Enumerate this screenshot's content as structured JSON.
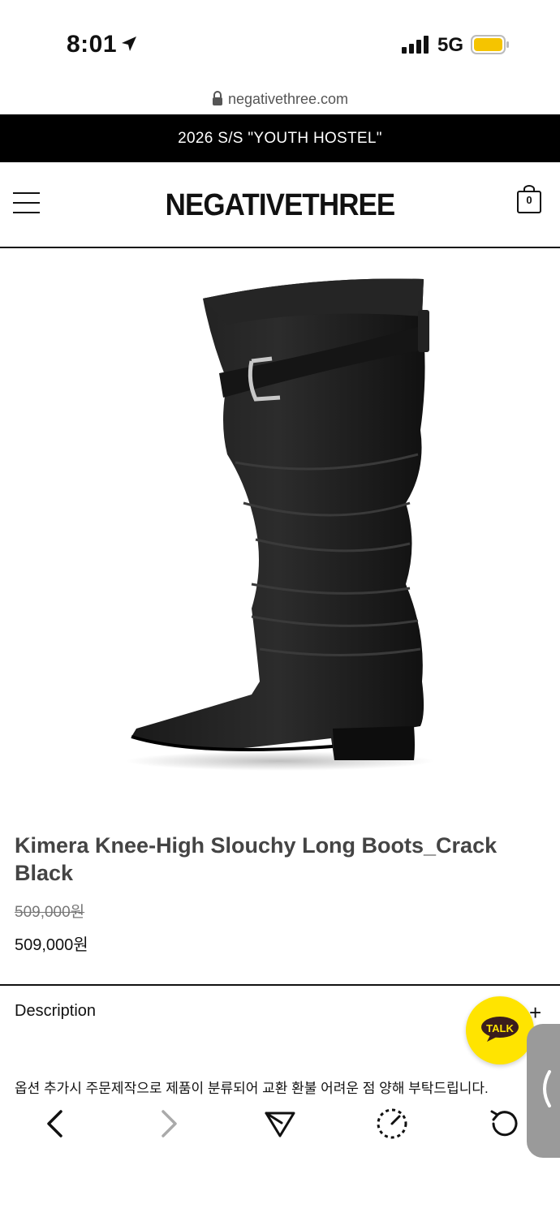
{
  "status": {
    "time": "8:01",
    "network": "5G",
    "battery_color": "#f5c400"
  },
  "browser": {
    "url": "negativethree.com"
  },
  "announcement": "2026 S/S \"YOUTH HOSTEL\"",
  "header": {
    "logo": "NEGATIVETHREE",
    "cart_count": "0",
    "menu_icon": "hamburger-icon",
    "cart_icon": "shopping-bag-icon"
  },
  "product": {
    "image": "black knee-high slouchy leather boot with buckle strap",
    "title": "Kimera Knee-High Slouchy Long Boots_Crack Black",
    "price_original": "509,000원",
    "price_current": "509,000원"
  },
  "description": {
    "label": "Description",
    "expand_icon": "+",
    "notice": "옵션 추가시 주문제작으로 제품이 분류되어 교환 환불 어려운 점 양해 부탁드립니다."
  },
  "chat": {
    "label": "TALK",
    "color": "#ffe400"
  },
  "toolbar": {
    "items": [
      "back-icon",
      "forward-icon",
      "share-icon",
      "speed-icon",
      "reload-icon"
    ]
  }
}
